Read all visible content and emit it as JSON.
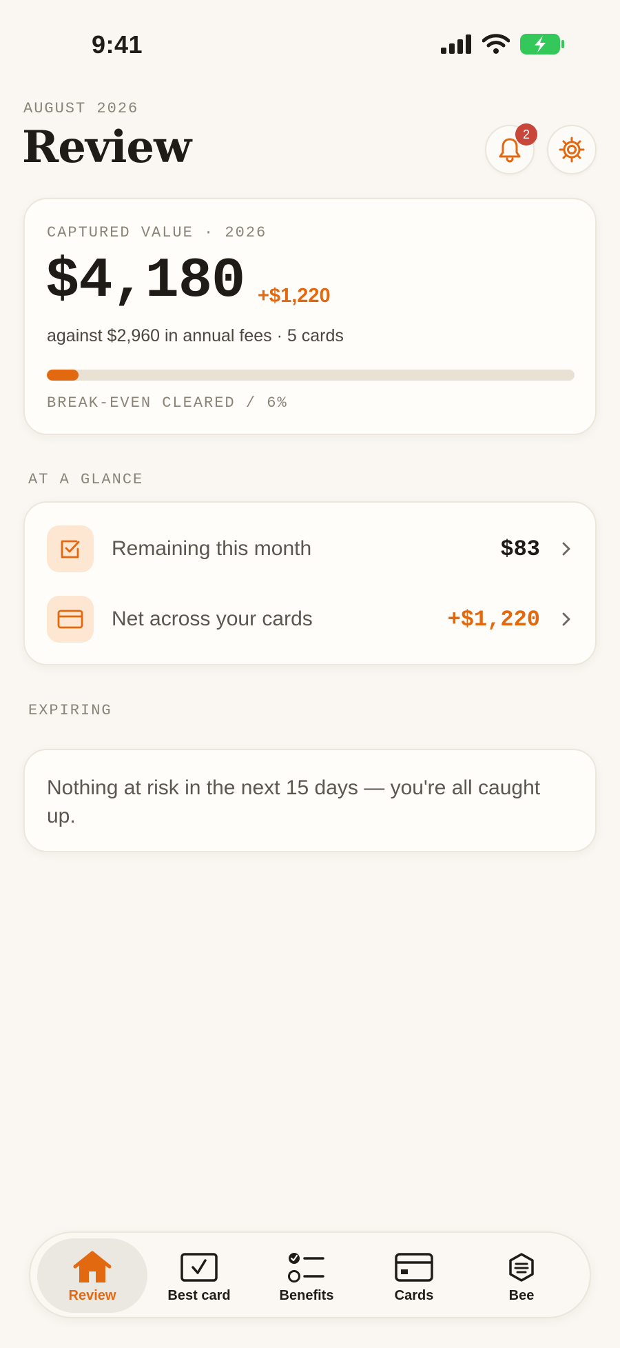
{
  "status_bar": {
    "time": "9:41"
  },
  "header": {
    "eyebrow": "AUGUST 2026",
    "title": "Review",
    "notification_count": "2"
  },
  "value_card": {
    "label": "CAPTURED VALUE · 2026",
    "amount": "$4,180",
    "delta": "+$1,220",
    "subtitle": "against $2,960 in annual fees · 5 cards",
    "progress_fraction": 0.06,
    "footer": "BREAK-EVEN CLEARED / 6%"
  },
  "glance": {
    "section_label": "AT A GLANCE",
    "rows": [
      {
        "icon": "checkbox-icon",
        "label": "Remaining this month",
        "value": "$83"
      },
      {
        "icon": "card-icon",
        "label": "Net across your cards",
        "value": "+$1,220"
      }
    ]
  },
  "expiring": {
    "section_label": "EXPIRING",
    "message": "Nothing at risk in the next 15 days — you're all caught up."
  },
  "tabs": [
    {
      "label": "Review",
      "icon": "house-icon",
      "active": true
    },
    {
      "label": "Best card",
      "icon": "checked-card-icon",
      "active": false
    },
    {
      "label": "Benefits",
      "icon": "list-icon",
      "active": false
    },
    {
      "label": "Cards",
      "icon": "card-icon",
      "active": false
    },
    {
      "label": "Bee",
      "icon": "bee-icon",
      "active": false
    }
  ],
  "colors": {
    "background": "#faf7f2",
    "accent": "#e2690f",
    "badge": "#c8463a",
    "battery": "#34c759"
  }
}
